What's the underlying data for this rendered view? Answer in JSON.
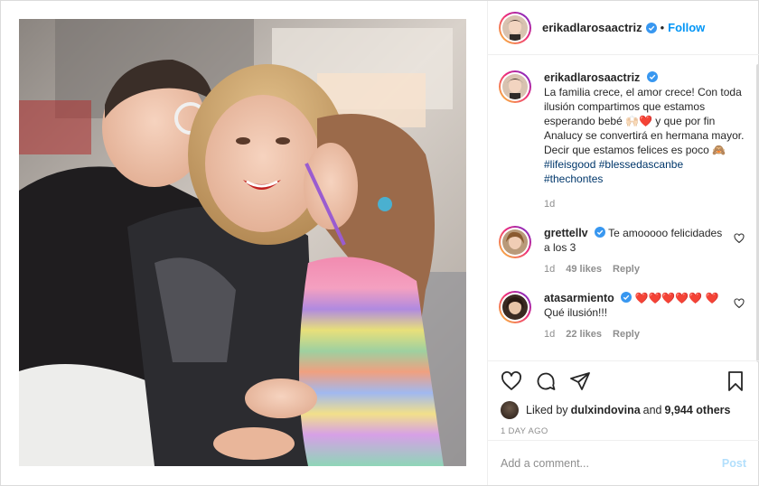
{
  "header": {
    "username": "erikadlarosaactriz",
    "separator": "•",
    "follow_label": "Follow"
  },
  "caption": {
    "username": "erikadlarosaactriz",
    "text_part1": "La familia crece, el amor crece! Con toda ilusión compartimos que estamos esperando bebé ",
    "emojis1": "🙌🏻❤️",
    "text_part2": " y que por fin Analucy se convertirá en hermana mayor. Decir que estamos felices es poco ",
    "emoji2": "🙈",
    "text_part3": " ",
    "hashtags": [
      "#lifeisgood",
      "#blessedascanbe",
      "#thechontes"
    ],
    "age": "1d"
  },
  "comments": [
    {
      "username": "grettellv",
      "text": "Te amooooo felicidades a los 3",
      "age": "1d",
      "likes": "49 likes",
      "reply": "Reply"
    },
    {
      "username": "atasarmiento",
      "text": "❤️❤️❤️❤️❤️ ❤️ Qué ilusión!!!",
      "age": "1d",
      "likes": "22 likes",
      "reply": "Reply"
    }
  ],
  "likes": {
    "prefix": "Liked by ",
    "user": "dulxindovina",
    "middle": " and ",
    "count": "9,944 others"
  },
  "timestamp": "1 DAY AGO",
  "add_comment": {
    "placeholder": "Add a comment...",
    "post_label": "Post"
  },
  "colors": {
    "accent": "#0095f6",
    "hashtag": "#00376b",
    "muted": "#8e8e8e",
    "post_disabled": "#b2dffc",
    "verified": "#3897f0"
  },
  "icons": [
    "verified-badge-icon",
    "heart-icon",
    "comment-icon",
    "share-icon",
    "save-icon",
    "small-heart-icon"
  ]
}
